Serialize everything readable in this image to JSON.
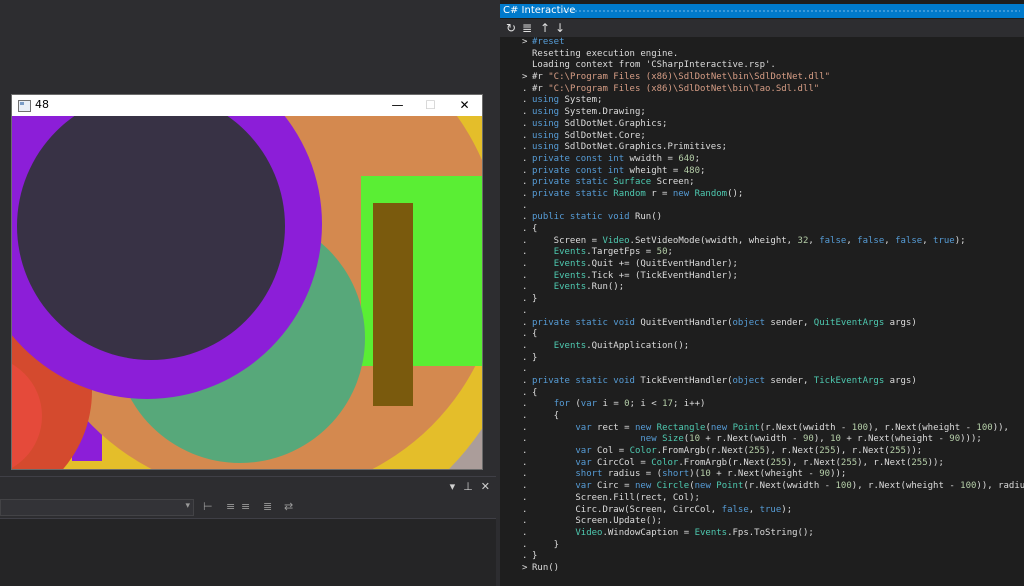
{
  "sdl_window": {
    "title": "48",
    "minimize_glyph": "—",
    "maximize_glyph": "☐",
    "close_glyph": "✕"
  },
  "interactive": {
    "title": "C# Interactive",
    "toolbar": {
      "reset_icon": "↻",
      "clear_icon": "≣",
      "history_up_icon": "↑",
      "history_down_icon": "↓"
    },
    "lines": [
      {
        "p": ">",
        "s": [
          [
            "#reset",
            "kw"
          ]
        ]
      },
      {
        "p": "",
        "s": [
          [
            "Resetting execution engine.",
            ""
          ]
        ]
      },
      {
        "p": "",
        "s": [
          [
            "Loading context from 'CSharpInteractive.rsp'.",
            ""
          ]
        ]
      },
      {
        "p": ">",
        "s": [
          [
            "#r ",
            ""
          ],
          [
            "\"C:\\Program Files (x86)\\SdlDotNet\\bin\\SdlDotNet.dll\"",
            "st"
          ]
        ]
      },
      {
        "p": ".",
        "s": [
          [
            "#r ",
            ""
          ],
          [
            "\"C:\\Program Files (x86)\\SdlDotNet\\bin\\Tao.Sdl.dll\"",
            "st"
          ]
        ]
      },
      {
        "p": ".",
        "s": [
          [
            "using",
            "kw"
          ],
          [
            " System;",
            ""
          ]
        ]
      },
      {
        "p": ".",
        "s": [
          [
            "using",
            "kw"
          ],
          [
            " System.Drawing;",
            ""
          ]
        ]
      },
      {
        "p": ".",
        "s": [
          [
            "using",
            "kw"
          ],
          [
            " SdlDotNet.Graphics;",
            ""
          ]
        ]
      },
      {
        "p": ".",
        "s": [
          [
            "using",
            "kw"
          ],
          [
            " SdlDotNet.Core;",
            ""
          ]
        ]
      },
      {
        "p": ".",
        "s": [
          [
            "using",
            "kw"
          ],
          [
            " SdlDotNet.Graphics.Primitives;",
            ""
          ]
        ]
      },
      {
        "p": ".",
        "s": [
          [
            "private const int",
            "kw"
          ],
          [
            " wwidth = ",
            ""
          ],
          [
            "640",
            "nm"
          ],
          [
            ";",
            ""
          ]
        ]
      },
      {
        "p": ".",
        "s": [
          [
            "private const int",
            "kw"
          ],
          [
            " wheight = ",
            ""
          ],
          [
            "480",
            "nm"
          ],
          [
            ";",
            ""
          ]
        ]
      },
      {
        "p": ".",
        "s": [
          [
            "private static",
            "kw"
          ],
          [
            " ",
            ""
          ],
          [
            "Surface",
            "ty"
          ],
          [
            " Screen;",
            ""
          ]
        ]
      },
      {
        "p": ".",
        "s": [
          [
            "private static",
            "kw"
          ],
          [
            " ",
            ""
          ],
          [
            "Random",
            "ty"
          ],
          [
            " r = ",
            ""
          ],
          [
            "new",
            "kw"
          ],
          [
            " ",
            ""
          ],
          [
            "Random",
            "ty"
          ],
          [
            "();",
            ""
          ]
        ]
      },
      {
        "p": ".",
        "s": []
      },
      {
        "p": ".",
        "s": [
          [
            "public static void",
            "kw"
          ],
          [
            " Run()",
            ""
          ]
        ]
      },
      {
        "p": ".",
        "s": [
          [
            "{",
            ""
          ]
        ]
      },
      {
        "p": ".",
        "s": [
          [
            "    Screen = ",
            ""
          ],
          [
            "Video",
            "ty"
          ],
          [
            ".SetVideoMode(wwidth, wheight, ",
            ""
          ],
          [
            "32",
            "nm"
          ],
          [
            ", ",
            ""
          ],
          [
            "false",
            "kw"
          ],
          [
            ", ",
            ""
          ],
          [
            "false",
            "kw"
          ],
          [
            ", ",
            ""
          ],
          [
            "false",
            "kw"
          ],
          [
            ", ",
            ""
          ],
          [
            "true",
            "kw"
          ],
          [
            ");",
            ""
          ]
        ]
      },
      {
        "p": ".",
        "s": [
          [
            "    ",
            ""
          ],
          [
            "Events",
            "ty"
          ],
          [
            ".TargetFps = ",
            ""
          ],
          [
            "50",
            "nm"
          ],
          [
            ";",
            ""
          ]
        ]
      },
      {
        "p": ".",
        "s": [
          [
            "    ",
            ""
          ],
          [
            "Events",
            "ty"
          ],
          [
            ".Quit += (QuitEventHandler);",
            ""
          ]
        ]
      },
      {
        "p": ".",
        "s": [
          [
            "    ",
            ""
          ],
          [
            "Events",
            "ty"
          ],
          [
            ".Tick += (TickEventHandler);",
            ""
          ]
        ]
      },
      {
        "p": ".",
        "s": [
          [
            "    ",
            ""
          ],
          [
            "Events",
            "ty"
          ],
          [
            ".Run();",
            ""
          ]
        ]
      },
      {
        "p": ".",
        "s": [
          [
            "}",
            ""
          ]
        ]
      },
      {
        "p": ".",
        "s": []
      },
      {
        "p": ".",
        "s": [
          [
            "private static void",
            "kw"
          ],
          [
            " QuitEventHandler(",
            ""
          ],
          [
            "object",
            "kw"
          ],
          [
            " sender, ",
            ""
          ],
          [
            "QuitEventArgs",
            "ty"
          ],
          [
            " args)",
            ""
          ]
        ]
      },
      {
        "p": ".",
        "s": [
          [
            "{",
            ""
          ]
        ]
      },
      {
        "p": ".",
        "s": [
          [
            "    ",
            ""
          ],
          [
            "Events",
            "ty"
          ],
          [
            ".QuitApplication();",
            ""
          ]
        ]
      },
      {
        "p": ".",
        "s": [
          [
            "}",
            ""
          ]
        ]
      },
      {
        "p": ".",
        "s": []
      },
      {
        "p": ".",
        "s": [
          [
            "private static void",
            "kw"
          ],
          [
            " TickEventHandler(",
            ""
          ],
          [
            "object",
            "kw"
          ],
          [
            " sender, ",
            ""
          ],
          [
            "TickEventArgs",
            "ty"
          ],
          [
            " args)",
            ""
          ]
        ]
      },
      {
        "p": ".",
        "s": [
          [
            "{",
            ""
          ]
        ]
      },
      {
        "p": ".",
        "s": [
          [
            "    ",
            ""
          ],
          [
            "for",
            "kw"
          ],
          [
            " (",
            ""
          ],
          [
            "var",
            "kw"
          ],
          [
            " i = ",
            ""
          ],
          [
            "0",
            "nm"
          ],
          [
            "; i < ",
            ""
          ],
          [
            "17",
            "nm"
          ],
          [
            "; i++)",
            ""
          ]
        ]
      },
      {
        "p": ".",
        "s": [
          [
            "    {",
            ""
          ]
        ]
      },
      {
        "p": ".",
        "s": [
          [
            "        ",
            ""
          ],
          [
            "var",
            "kw"
          ],
          [
            " rect = ",
            ""
          ],
          [
            "new",
            "kw"
          ],
          [
            " ",
            ""
          ],
          [
            "Rectangle",
            "ty"
          ],
          [
            "(",
            ""
          ],
          [
            "new",
            "kw"
          ],
          [
            " ",
            ""
          ],
          [
            "Point",
            "ty"
          ],
          [
            "(r.Next(wwidth - ",
            ""
          ],
          [
            "100",
            "nm"
          ],
          [
            "), r.Next(wheight - ",
            ""
          ],
          [
            "100",
            "nm"
          ],
          [
            ")),",
            ""
          ]
        ]
      },
      {
        "p": ".",
        "s": [
          [
            "                    ",
            ""
          ],
          [
            "new",
            "kw"
          ],
          [
            " ",
            ""
          ],
          [
            "Size",
            "ty"
          ],
          [
            "(",
            ""
          ],
          [
            "10",
            "nm"
          ],
          [
            " + r.Next(wwidth - ",
            ""
          ],
          [
            "90",
            "nm"
          ],
          [
            "), ",
            ""
          ],
          [
            "10",
            "nm"
          ],
          [
            " + r.Next(wheight - ",
            ""
          ],
          [
            "90",
            "nm"
          ],
          [
            ")));",
            ""
          ]
        ]
      },
      {
        "p": ".",
        "s": [
          [
            "        ",
            ""
          ],
          [
            "var",
            "kw"
          ],
          [
            " Col = ",
            ""
          ],
          [
            "Color",
            "ty"
          ],
          [
            ".FromArgb(r.Next(",
            ""
          ],
          [
            "255",
            "nm"
          ],
          [
            "), r.Next(",
            ""
          ],
          [
            "255",
            "nm"
          ],
          [
            "), r.Next(",
            ""
          ],
          [
            "255",
            "nm"
          ],
          [
            "));",
            ""
          ]
        ]
      },
      {
        "p": ".",
        "s": [
          [
            "        ",
            ""
          ],
          [
            "var",
            "kw"
          ],
          [
            " CircCol = ",
            ""
          ],
          [
            "Color",
            "ty"
          ],
          [
            ".FromArgb(r.Next(",
            ""
          ],
          [
            "255",
            "nm"
          ],
          [
            "), r.Next(",
            ""
          ],
          [
            "255",
            "nm"
          ],
          [
            "), r.Next(",
            ""
          ],
          [
            "255",
            "nm"
          ],
          [
            "));",
            ""
          ]
        ]
      },
      {
        "p": ".",
        "s": [
          [
            "        ",
            ""
          ],
          [
            "short",
            "kw"
          ],
          [
            " radius = (",
            ""
          ],
          [
            "short",
            "kw"
          ],
          [
            ")(",
            ""
          ],
          [
            "10",
            "nm"
          ],
          [
            " + r.Next(wheight - ",
            ""
          ],
          [
            "90",
            "nm"
          ],
          [
            "));",
            ""
          ]
        ]
      },
      {
        "p": ".",
        "s": [
          [
            "        ",
            ""
          ],
          [
            "var",
            "kw"
          ],
          [
            " Circ = ",
            ""
          ],
          [
            "new",
            "kw"
          ],
          [
            " ",
            ""
          ],
          [
            "Circle",
            "ty"
          ],
          [
            "(",
            ""
          ],
          [
            "new",
            "kw"
          ],
          [
            " ",
            ""
          ],
          [
            "Point",
            "ty"
          ],
          [
            "(r.Next(wwidth - ",
            ""
          ],
          [
            "100",
            "nm"
          ],
          [
            "), r.Next(wheight - ",
            ""
          ],
          [
            "100",
            "nm"
          ],
          [
            ")), radius);",
            ""
          ]
        ]
      },
      {
        "p": ".",
        "s": [
          [
            "        Screen.Fill(rect, Col);",
            ""
          ]
        ]
      },
      {
        "p": ".",
        "s": [
          [
            "        Circ.Draw(Screen, CircCol, ",
            ""
          ],
          [
            "false",
            "kw"
          ],
          [
            ", ",
            ""
          ],
          [
            "true",
            "kw"
          ],
          [
            ");",
            ""
          ]
        ]
      },
      {
        "p": ".",
        "s": [
          [
            "        Screen.Update();",
            ""
          ]
        ]
      },
      {
        "p": ".",
        "s": [
          [
            "        ",
            ""
          ],
          [
            "Video",
            "ty"
          ],
          [
            ".WindowCaption = ",
            ""
          ],
          [
            "Events",
            "ty"
          ],
          [
            ".Fps.ToString();",
            ""
          ]
        ]
      },
      {
        "p": ".",
        "s": [
          [
            "    }",
            ""
          ]
        ]
      },
      {
        "p": ".",
        "s": [
          [
            "}",
            ""
          ]
        ]
      },
      {
        "p": ">",
        "s": [
          [
            "Run()",
            ""
          ]
        ]
      }
    ]
  },
  "bottom_panel": {
    "controls": [
      "▾",
      "⊥",
      "✕"
    ],
    "dropdown_chevron": "▾"
  },
  "colors": {
    "ide_background": "#2d2d30",
    "editor_background": "#1e1e1e",
    "accent": "#007acc",
    "keyword": "#569cd6",
    "type": "#4ec9b0",
    "string": "#d69d85",
    "number": "#b5cea8",
    "canvas_shapes": [
      "#e98a56",
      "#1f4f8f",
      "#8c1ed8",
      "#383245",
      "#57a87a",
      "#5aee34",
      "#7a5a0d",
      "#d88a1e",
      "#d44a2e",
      "#e4be2a",
      "#ab9d9a"
    ]
  }
}
